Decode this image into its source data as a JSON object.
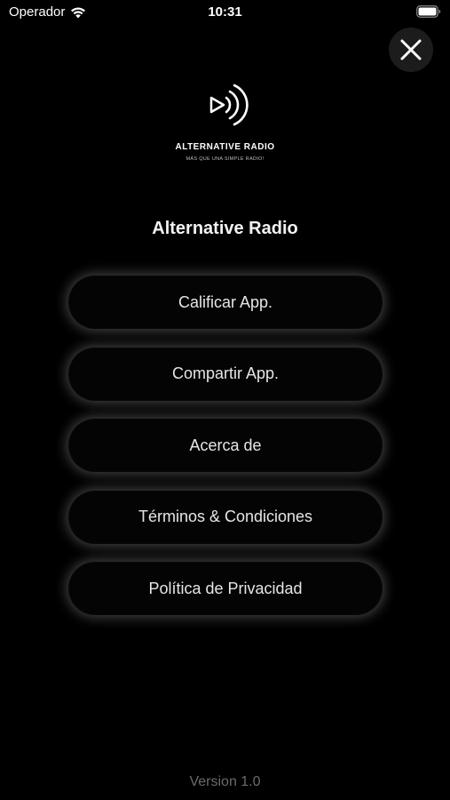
{
  "status_bar": {
    "carrier": "Operador",
    "time": "10:31"
  },
  "logo": {
    "name": "ALTERNATIVE RADIO",
    "tagline": "MÁS QUE UNA SIMPLE RADIO!"
  },
  "app_title": "Alternative Radio",
  "menu": {
    "items": [
      {
        "label": "Calificar App."
      },
      {
        "label": "Compartir App."
      },
      {
        "label": "Acerca de"
      },
      {
        "label": "Términos & Condiciones"
      },
      {
        "label": "Política de Privacidad"
      }
    ]
  },
  "footer": {
    "version": "Version 1.0"
  },
  "icons": {
    "close": "close-icon",
    "wifi": "wifi-icon",
    "battery": "battery-icon",
    "logo": "play-radio-waves-icon"
  },
  "colors": {
    "background": "#000000",
    "text": "#ffffff",
    "button_glow": "#ffffff",
    "version_text": "#6b6b6b"
  }
}
